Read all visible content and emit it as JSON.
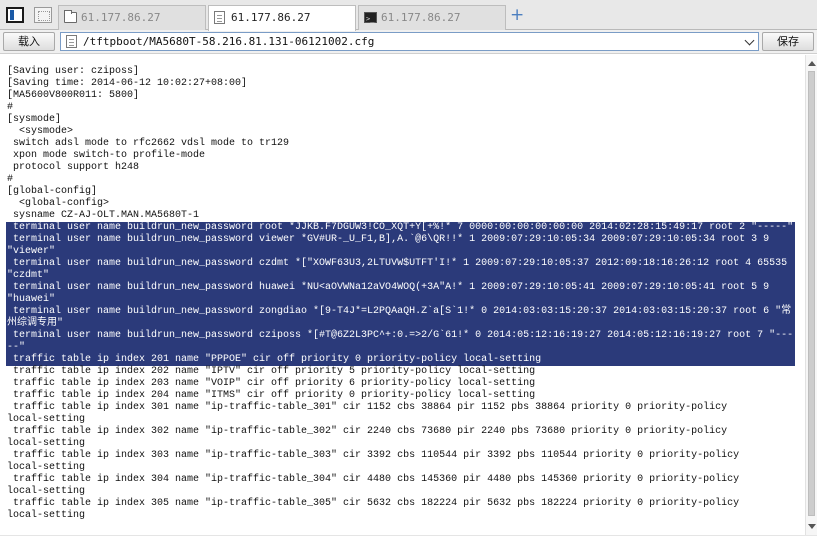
{
  "tabs": [
    {
      "label": "61.177.86.27",
      "icon": "folder-icon",
      "active": false
    },
    {
      "label": "61.177.86.27",
      "icon": "document-icon",
      "active": true
    },
    {
      "label": "61.177.86.27",
      "icon": "terminal-icon",
      "active": false
    }
  ],
  "toolbar": {
    "load_label": "载入",
    "save_label": "保存",
    "path": "/tftpboot/MA5680T-58.216.81.131-06121002.cfg"
  },
  "file_lines": [
    {
      "text": "[Saving user: cziposs]",
      "selected": false
    },
    {
      "text": "[Saving time: 2014-06-12 10:02:27+08:00]",
      "selected": false
    },
    {
      "text": "[MA5600V800R011: 5800]",
      "selected": false
    },
    {
      "text": "#",
      "selected": false
    },
    {
      "text": "[sysmode]",
      "selected": false
    },
    {
      "text": "  <sysmode>",
      "selected": false
    },
    {
      "text": " switch adsl mode to rfc2662 vdsl mode to tr129",
      "selected": false
    },
    {
      "text": " xpon mode switch-to profile-mode",
      "selected": false
    },
    {
      "text": " protocol support h248",
      "selected": false
    },
    {
      "text": "#",
      "selected": false
    },
    {
      "text": "[global-config]",
      "selected": false
    },
    {
      "text": "  <global-config>",
      "selected": false
    },
    {
      "text": " sysname CZ-AJ-OLT.MAN.MA5680T-1",
      "selected": false
    },
    {
      "text": " terminal user name buildrun_new_password root *JJKB.F7DGUW3!CO_XQT+Y[+%!* 7 0000:00:00:00:00:00 2014:02:28:15:49:17 root 2 \"-----\"",
      "selected": true
    },
    {
      "text": " terminal user name buildrun_new_password viewer *GV#UR-_U_F1,B],A.`@6\\QR!!* 1 2009:07:29:10:05:34 2009:07:29:10:05:34 root 3 9",
      "selected": true
    },
    {
      "text": "\"viewer\"",
      "selected": true
    },
    {
      "text": " terminal user name buildrun_new_password czdmt *[\"XOWF63U3,2LTUVW$UTFT'I!* 1 2009:07:29:10:05:37 2012:09:18:16:26:12 root 4 65535",
      "selected": true
    },
    {
      "text": "\"czdmt\"",
      "selected": true
    },
    {
      "text": " terminal user name buildrun_new_password huawei *NU<aOVWNa12aVO4WOQ(+3A\"A!* 1 2009:07:29:10:05:41 2009:07:29:10:05:41 root 5 9",
      "selected": true
    },
    {
      "text": "\"huawei\"",
      "selected": true
    },
    {
      "text": " terminal user name buildrun_new_password zongdiao *[9-T4J*=L2PQAaQH.Z`a[S`1!* 0 2014:03:03:15:20:37 2014:03:03:15:20:37 root 6 \"常",
      "selected": true
    },
    {
      "text": "州综调专用\"",
      "selected": true
    },
    {
      "text": " terminal user name buildrun_new_password cziposs *[#T@6Z2L3PC^+:0.=>2/G`61!* 0 2014:05:12:16:19:27 2014:05:12:16:19:27 root 7 \"---",
      "selected": true
    },
    {
      "text": "--\"",
      "selected": true
    },
    {
      "text": " traffic table ip index 201 name \"PPPOE\" cir off priority 0 priority-policy local-setting",
      "selected": true
    },
    {
      "text": " traffic table ip index 202 name \"IPTV\" cir off priority 5 priority-policy local-setting",
      "selected": false
    },
    {
      "text": " traffic table ip index 203 name \"VOIP\" cir off priority 6 priority-policy local-setting",
      "selected": false
    },
    {
      "text": " traffic table ip index 204 name \"ITMS\" cir off priority 0 priority-policy local-setting",
      "selected": false
    },
    {
      "text": " traffic table ip index 301 name \"ip-traffic-table_301\" cir 1152 cbs 38864 pir 1152 pbs 38864 priority 0 priority-policy",
      "selected": false
    },
    {
      "text": "local-setting",
      "selected": false
    },
    {
      "text": " traffic table ip index 302 name \"ip-traffic-table_302\" cir 2240 cbs 73680 pir 2240 pbs 73680 priority 0 priority-policy",
      "selected": false
    },
    {
      "text": "local-setting",
      "selected": false
    },
    {
      "text": " traffic table ip index 303 name \"ip-traffic-table_303\" cir 3392 cbs 110544 pir 3392 pbs 110544 priority 0 priority-policy",
      "selected": false
    },
    {
      "text": "local-setting",
      "selected": false
    },
    {
      "text": " traffic table ip index 304 name \"ip-traffic-table_304\" cir 4480 cbs 145360 pir 4480 pbs 145360 priority 0 priority-policy",
      "selected": false
    },
    {
      "text": "local-setting",
      "selected": false
    },
    {
      "text": " traffic table ip index 305 name \"ip-traffic-table_305\" cir 5632 cbs 182224 pir 5632 pbs 182224 priority 0 priority-policy",
      "selected": false
    },
    {
      "text": "local-setting",
      "selected": false
    }
  ]
}
